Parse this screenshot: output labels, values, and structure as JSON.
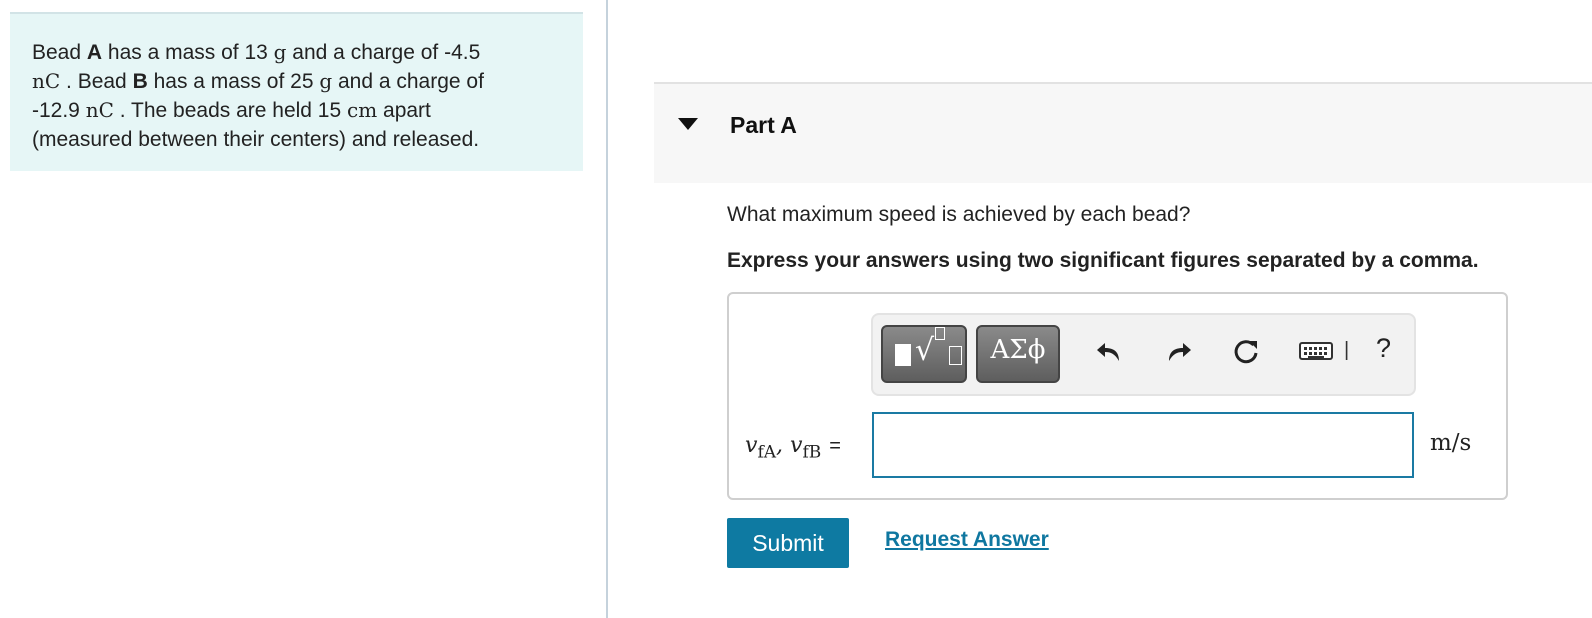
{
  "problem": {
    "s1": "Bead ",
    "bead_a": "A",
    "s2": " has a mass of 13 ",
    "g1": "g",
    "s3": " and a charge of -4.5",
    "nc1": "nC",
    "s4": " . Bead ",
    "bead_b": "B",
    "s5": " has a mass of 25 ",
    "g2": "g",
    "s6": " and a charge of",
    "s7": "-12.9 ",
    "nc2": "nC",
    "s8": " . The beads are held 15 ",
    "cm": "cm",
    "s9": " apart",
    "s10": "(measured between their centers) and released."
  },
  "part": {
    "title": "Part A",
    "question": "What maximum speed is achieved by each bead?",
    "instruction": "Express your answers using two significant figures separated by a comma."
  },
  "toolbar": {
    "greek_label": "ΑΣϕ",
    "help_label": "?",
    "separator": "|"
  },
  "answer": {
    "var_a": "v",
    "sub_a": "fA",
    "comma": ", ",
    "var_b": "v",
    "sub_b": "fB",
    "equals": "=",
    "value": "",
    "units": "m/s"
  },
  "actions": {
    "submit_label": "Submit",
    "request_label": "Request Answer"
  }
}
